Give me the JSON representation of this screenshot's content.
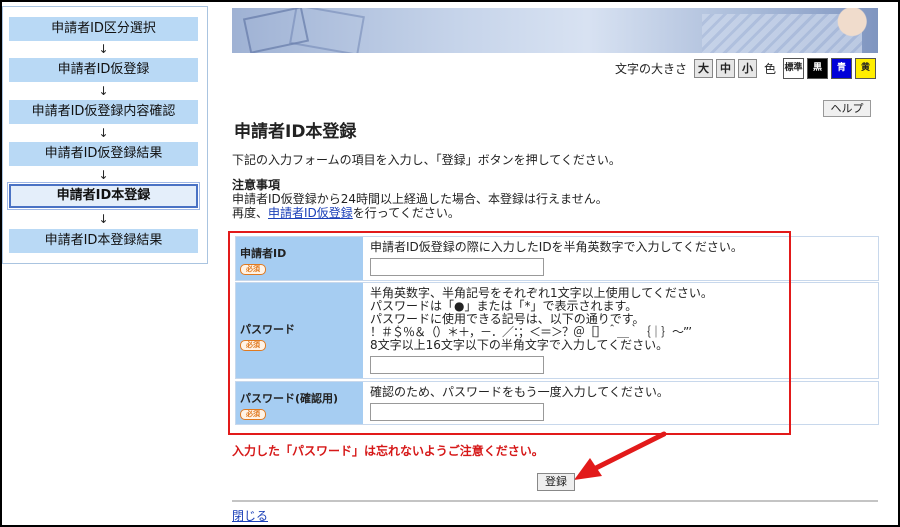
{
  "steps": [
    {
      "label": "申請者ID区分選択"
    },
    {
      "label": "申請者ID仮登録"
    },
    {
      "label": "申請者ID仮登録内容確認"
    },
    {
      "label": "申請者ID仮登録結果"
    },
    {
      "label": "申請者ID本登録"
    },
    {
      "label": "申請者ID本登録結果"
    }
  ],
  "step_arrow": "↓",
  "fontbar": {
    "size_label": "文字の大きさ",
    "large": "大",
    "medium": "中",
    "small": "小",
    "color_label": "色",
    "standard": "標準",
    "black": "黒",
    "blue": "青",
    "yellow": "黄"
  },
  "help_label": "ヘルプ",
  "title": "申請者ID本登録",
  "intro": "下記の入力フォームの項目を入力し、「登録」ボタンを押してください。",
  "notice": {
    "heading": "注意事項",
    "line1": "申請者ID仮登録から24時間以上経過した場合、本登録は行えません。",
    "line2_pre": "再度、",
    "line2_link": "申請者ID仮登録",
    "line2_post": "を行ってください。"
  },
  "required_badge": "必須",
  "form": {
    "id": {
      "label": "申請者ID",
      "desc": "申請者ID仮登録の際に入力したIDを半角英数字で入力してください。",
      "value": ""
    },
    "password": {
      "label": "パスワード",
      "desc1": "半角英数字、半角記号をそれぞれ1文字以上使用してください。",
      "desc2": "パスワードは「●」または「*」で表示されます。",
      "desc3": "パスワードに使用できる記号は、以下の通りです。",
      "desc4": "！＃＄％＆（）＊＋，－．／：；＜＝＞？＠［］＾＿｀｛｜｝～”’",
      "desc5": "8文字以上16文字以下の半角文字で入力してください。",
      "value": ""
    },
    "password_confirm": {
      "label": "パスワード(確認用)",
      "desc": "確認のため、パスワードをもう一度入力してください。",
      "value": ""
    }
  },
  "warning": "入力した「パスワード」は忘れないようご注意ください。",
  "submit_label": "登録",
  "close_label": "閉じる",
  "colors": {
    "step_bg": "#b9d9f5",
    "label_bg": "#a6cdf2",
    "highlight_red": "#e21a1a",
    "link_blue": "#1a3fb8"
  }
}
